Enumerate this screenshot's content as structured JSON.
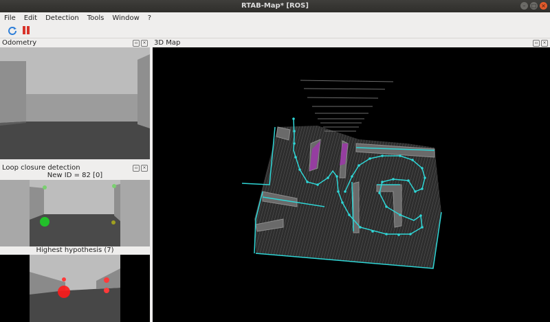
{
  "window": {
    "title": "RTAB-Map* [ROS]"
  },
  "menu": [
    "File",
    "Edit",
    "Detection",
    "Tools",
    "Window",
    "?"
  ],
  "odometry": {
    "title": "Odometry"
  },
  "loop": {
    "title": "Loop closure detection",
    "new_id_label": "New ID = 82 [0]",
    "hypothesis_label": "Highest hypothesis (7)"
  },
  "map3d": {
    "title": "3D Map"
  },
  "colors": {
    "trajectory": "#2fd6d6",
    "loop_match": "#ff1a1a",
    "feature_green": "#22c02a"
  }
}
